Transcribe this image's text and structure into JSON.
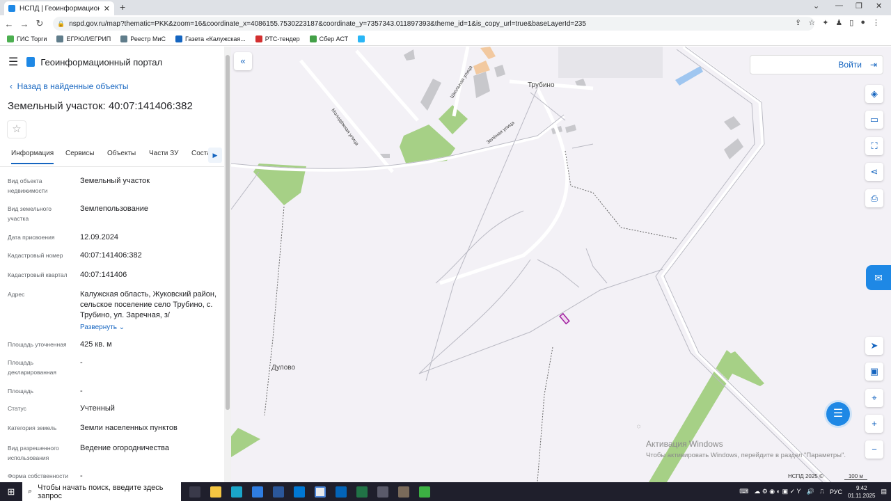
{
  "browser": {
    "tab_title": "НСПД | Геоинформационный п",
    "tab_close": "✕",
    "new_tab": "+",
    "url": "nspd.gov.ru/map?thematic=PKK&zoom=16&coordinate_x=4086155.7530223187&coordinate_y=7357343.011897393&theme_id=1&is_copy_url=true&baseLayerId=235",
    "bookmarks": [
      {
        "label": "ГИС Торги",
        "color": "#4caf50"
      },
      {
        "label": "ЕГРЮЛ/ЕГРИП",
        "color": "#607d8b"
      },
      {
        "label": "Реестр МиС",
        "color": "#607d8b"
      },
      {
        "label": "Газета «Калужская...",
        "color": "#1565c0"
      },
      {
        "label": "РТС-тендер",
        "color": "#d32f2f"
      },
      {
        "label": "Сбер АСТ",
        "color": "#43a047"
      },
      {
        "label": "",
        "color": "#29b6f6"
      }
    ]
  },
  "sidebar": {
    "app_title": "Геоинформационный портал",
    "back_link": "Назад в найденные объекты",
    "object_title": "Земельный участок: 40:07:141406:382",
    "tabs": [
      "Информация",
      "Сервисы",
      "Объекты",
      "Части ЗУ",
      "Соста"
    ],
    "fields": [
      {
        "label": "Вид объекта недвижимости",
        "value": "Земельный участок"
      },
      {
        "label": "Вид земельного участка",
        "value": "Землепользование"
      },
      {
        "label": "Дата присвоения",
        "value": "12.09.2024"
      },
      {
        "label": "Кадастровый номер",
        "value": "40:07:141406:382"
      },
      {
        "label": "Кадастровый квартал",
        "value": "40:07:141406"
      },
      {
        "label": "Адрес",
        "value": "Калужская область, Жуковский район, сельское поселение село Трубино, с. Трубино, ул. Заречная, з/"
      },
      {
        "label": "Площадь уточненная",
        "value": "425 кв. м"
      },
      {
        "label": "Площадь декларированная",
        "value": "-"
      },
      {
        "label": "Площадь",
        "value": "-"
      },
      {
        "label": "Статус",
        "value": "Учтенный"
      },
      {
        "label": "Категория земель",
        "value": "Земли населенных пунктов"
      },
      {
        "label": "Вид разрешенного использования",
        "value": "Ведение огородничества"
      },
      {
        "label": "Форма собственности",
        "value": "-"
      }
    ],
    "expand_label": "Развернуть"
  },
  "map": {
    "login_label": "Войти",
    "labels": {
      "trubino": "Трубино",
      "dulovo": "Дулово",
      "molodezhnaya": "Молодёжная улица",
      "shkolnaya": "Школьная улица",
      "zelenaya": "Зелёная улица"
    },
    "watermark_title": "Активация Windows",
    "watermark_sub": "Чтобы активировать Windows, перейдите в раздел \"Параметры\".",
    "copyright": "НСПД 2025 ©",
    "scale": "100 м"
  },
  "taskbar": {
    "search_placeholder": "Чтобы начать поиск, введите здесь запрос",
    "lang": "РУС",
    "time": "9:42",
    "date": "01.11.2025"
  }
}
